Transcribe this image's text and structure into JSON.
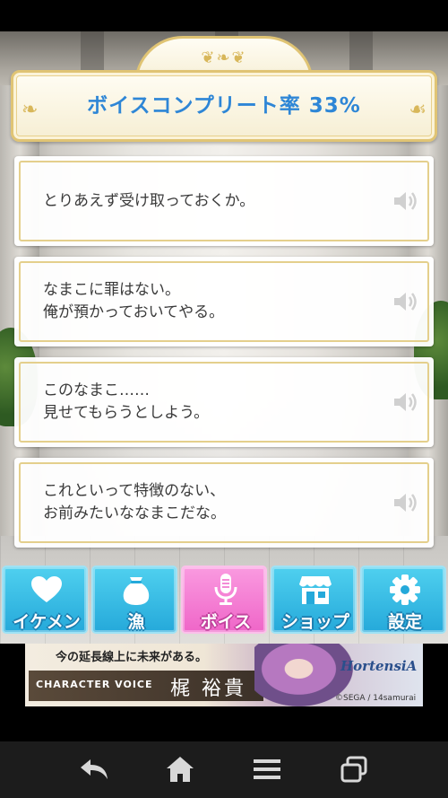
{
  "title_banner": {
    "text": "ボイスコンプリート率 33%"
  },
  "voice_lines": [
    {
      "line1": "とりあえず受け取っておくか。",
      "line2": ""
    },
    {
      "line1": "なまこに罪はない。",
      "line2": "俺が預かっておいてやる。"
    },
    {
      "line1": "このなまこ……",
      "line2": "見せてもらうとしよう。"
    },
    {
      "line1": "これといって特徴のない、",
      "line2": "お前みたいななまこだな。"
    }
  ],
  "nav": {
    "items": [
      {
        "label": "イケメン",
        "icon": "heart-icon"
      },
      {
        "label": "漁",
        "icon": "pouch-icon"
      },
      {
        "label": "ボイス",
        "icon": "microphone-icon",
        "active": true
      },
      {
        "label": "ショップ",
        "icon": "shop-icon"
      },
      {
        "label": "設定",
        "icon": "gear-icon"
      }
    ]
  },
  "ad": {
    "tagline": "今の延長線上に未来がある。",
    "cv_label": "CHARACTER VOICE",
    "cv_name": "梶 裕貴",
    "logo": "HortensiA",
    "copyright": "©SEGA / 14samurai"
  },
  "colors": {
    "nav_blue": "#25a9da",
    "nav_pink": "#ef66c8",
    "title_blue": "#2e86d6",
    "gold_border": "#e0c474"
  }
}
